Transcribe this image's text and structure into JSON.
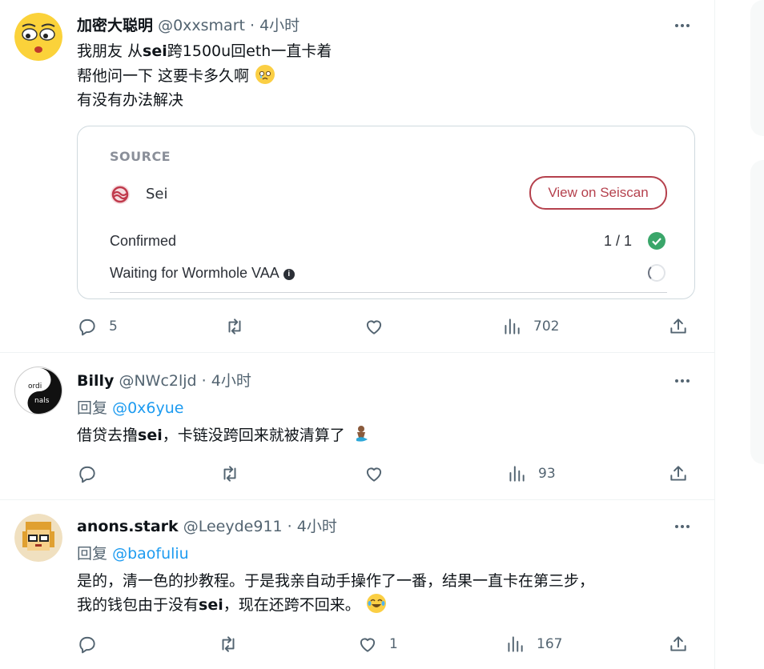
{
  "tweets": [
    {
      "name": "加密大聪明",
      "handle": "@0xxsmart",
      "time": "4小时",
      "lines": [
        "我朋友 从",
        "sei",
        "跨1500u回eth一直卡着",
        "帮他问一下 这要卡多久啊",
        "有没有办法解决"
      ],
      "card": {
        "source_label": "SOURCE",
        "chain_name": "Sei",
        "view_button": "View on Seiscan",
        "confirmed_label": "Confirmed",
        "confirmed_value": "1 / 1",
        "waiting_label": "Waiting for Wormhole VAA",
        "info_glyph": "i"
      },
      "replies": "5",
      "retweets": "",
      "likes": "",
      "views": "702"
    },
    {
      "name": "Billy",
      "handle": "@NWc2ljd",
      "time": "4小时",
      "reply_prefix": "回复",
      "reply_handle": "@0x6yue",
      "text_a": "借贷去撸",
      "text_bold": "sei",
      "text_b": "，卡链没跨回来就被清算了",
      "avatar_top": "ordi",
      "avatar_bottom": "nals",
      "replies": "",
      "retweets": "",
      "likes": "",
      "views": "93"
    },
    {
      "name": "anons.stark",
      "handle": "@Leeyde911",
      "time": "4小时",
      "reply_prefix": "回复",
      "reply_handle": "@baofuliu",
      "line1": "是的，清一色的抄教程。于是我亲自动手操作了一番，结果一直卡在第三步，",
      "line2_a": "我的钱包由于没有",
      "line2_bold": "sei",
      "line2_b": "，现在还跨不回来。",
      "replies": "",
      "retweets": "",
      "likes": "1",
      "views": "167"
    }
  ],
  "separator": "·",
  "colors": {
    "accent": "#1d9bf0",
    "muted": "#536471",
    "sei_red": "#b5414d",
    "success": "#3aa66a"
  },
  "icons": [
    "more-icon",
    "reply-icon",
    "retweet-icon",
    "like-icon",
    "views-icon",
    "share-icon",
    "sei-logo-icon",
    "check-icon",
    "spinner-icon",
    "info-icon"
  ]
}
